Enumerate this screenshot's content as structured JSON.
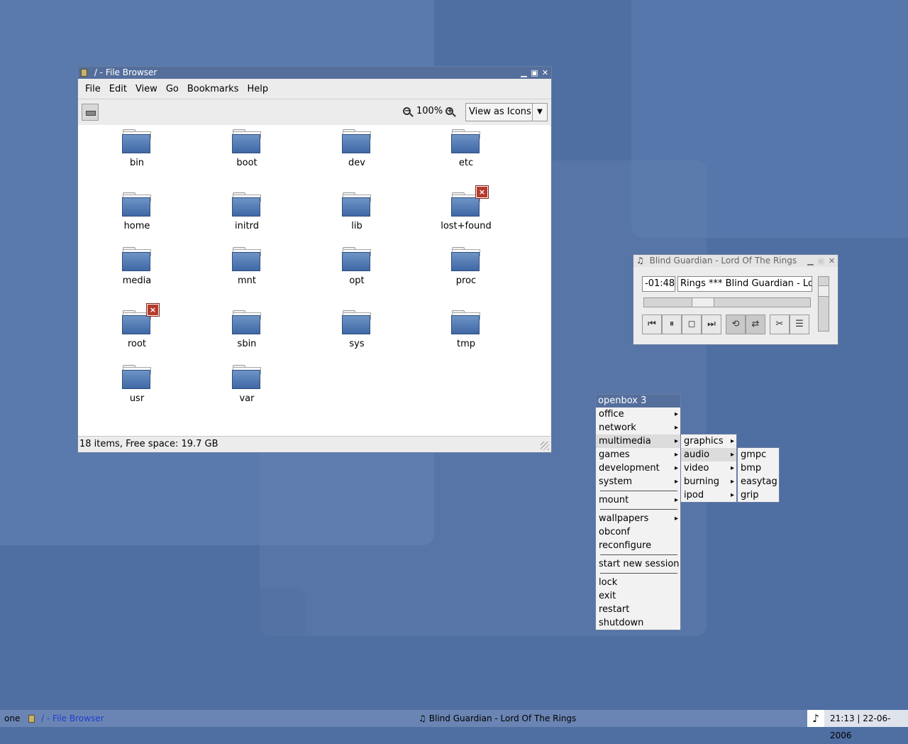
{
  "file_browser": {
    "title": "/ - File Browser",
    "menu": [
      "File",
      "Edit",
      "View",
      "Go",
      "Bookmarks",
      "Help"
    ],
    "zoom": "100%",
    "view_mode": "View as Icons",
    "folders": [
      {
        "name": "bin",
        "locked": false
      },
      {
        "name": "boot",
        "locked": false
      },
      {
        "name": "dev",
        "locked": false
      },
      {
        "name": "etc",
        "locked": false
      },
      {
        "name": "home",
        "locked": false
      },
      {
        "name": "initrd",
        "locked": false
      },
      {
        "name": "lib",
        "locked": false
      },
      {
        "name": "lost+found",
        "locked": true
      },
      {
        "name": "media",
        "locked": false
      },
      {
        "name": "mnt",
        "locked": false
      },
      {
        "name": "opt",
        "locked": false
      },
      {
        "name": "proc",
        "locked": false
      },
      {
        "name": "root",
        "locked": true
      },
      {
        "name": "sbin",
        "locked": false
      },
      {
        "name": "sys",
        "locked": false
      },
      {
        "name": "tmp",
        "locked": false
      },
      {
        "name": "usr",
        "locked": false
      },
      {
        "name": "var",
        "locked": false
      }
    ],
    "status": "18 items, Free space: 19.7 GB"
  },
  "player": {
    "title": "Blind Guardian - Lord Of The Rings",
    "time": "-01:48",
    "marquee": "Rings  ***  Blind Guardian - Lord Of The Rings",
    "seek_position": 0.33,
    "volume": 0.8,
    "buttons": {
      "prev": "⏮",
      "pause": "⏸",
      "stop": "◻",
      "next": "⏭",
      "repeat": "⟲",
      "shuffle": "⇄",
      "prefs": "✂",
      "playlist": "☰"
    }
  },
  "root_menu": {
    "title": "openbox 3",
    "items": {
      "office": "office",
      "network": "network",
      "multimedia": "multimedia",
      "games": "games",
      "development": "development",
      "system": "system",
      "mount": "mount",
      "wallpapers": "wallpapers",
      "obconf": "obconf",
      "reconfigure": "reconfigure",
      "start_new_session": "start new session",
      "lock": "lock",
      "exit": "exit",
      "restart": "restart",
      "shutdown": "shutdown"
    }
  },
  "multimedia_menu": {
    "graphics": "graphics",
    "audio": "audio",
    "video": "video",
    "burning": "burning",
    "ipod": "ipod"
  },
  "audio_menu": {
    "gmpc": "gmpc",
    "bmp": "bmp",
    "easytag": "easytag",
    "grip": "grip"
  },
  "taskbar": {
    "desktop": "one",
    "task1": "/ - File Browser",
    "task2": "Blind Guardian - Lord Of The Rings",
    "clock": "21:13 | 22-06-2006"
  },
  "colors": {
    "desktop": "#4f6fa3",
    "titlebar": "#556f9c",
    "taskbar": "#6a85b3",
    "lock_badge": "#b53a2c"
  }
}
